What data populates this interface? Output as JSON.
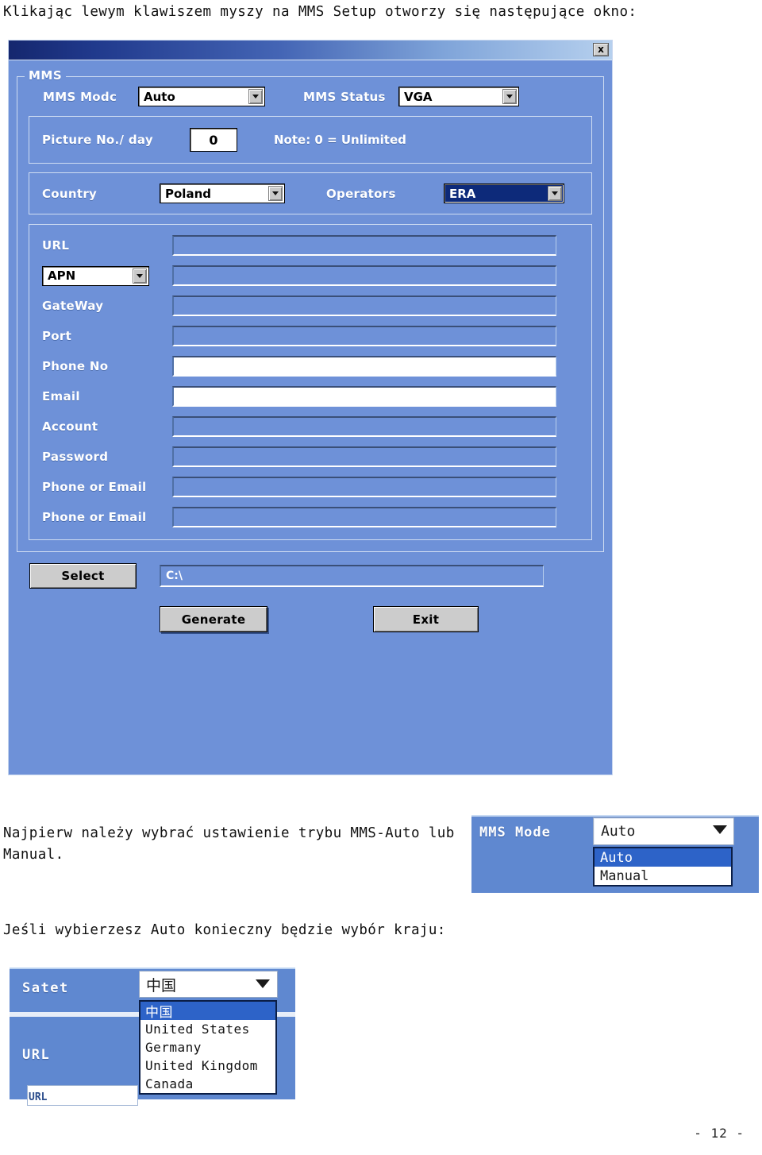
{
  "document": {
    "intro_text": "Klikając lewym klawiszem myszy na MMS Setup otworzy się następujące okno:",
    "middle_text_line1": "Najpierw należy wybrać ustawienie trybu MMS-Auto lub",
    "middle_text_line2": "Manual.",
    "third_text": "Jeśli wybierzesz Auto konieczny będzie wybór kraju:",
    "page_number": "- 12 -"
  },
  "dialog": {
    "close_label": "x",
    "mms_group": {
      "title": "MMS",
      "mode_label": "MMS Modc",
      "mode_value": "Auto",
      "status_label": "MMS Status",
      "status_value": "VGA",
      "picture_label": "Picture No./ day",
      "picture_value": "0",
      "picture_note": "Note: 0 = Unlimited",
      "country_label": "Country",
      "country_value": "Poland",
      "operators_label": "Operators",
      "operators_value": "ERA"
    },
    "network": {
      "url_label": "URL",
      "url_value": "",
      "apn_label": "APN",
      "apn_value": "",
      "gateway_label": "GateWay",
      "gateway_value": "",
      "port_label": "Port",
      "port_value": "",
      "phone_no_label": "Phone No",
      "phone_no_value": "",
      "email_label": "Email",
      "email_value": "",
      "account_label": "Account",
      "account_value": "",
      "password_label": "Password",
      "password_value": "",
      "phone_or_email_1_label": "Phone or Email",
      "phone_or_email_1_value": "",
      "phone_or_email_2_label": "Phone or Email",
      "phone_or_email_2_value": ""
    },
    "bottom": {
      "select_label": "Select",
      "path_value": "C:\\",
      "generate_label": "Generate",
      "exit_label": "Exit"
    }
  },
  "mms_mode_inset": {
    "label": "MMS Mode",
    "selected": "Auto",
    "options": [
      {
        "label": "Auto",
        "selected": true
      },
      {
        "label": "Manual",
        "selected": false
      }
    ]
  },
  "country_inset": {
    "label": "Satet",
    "url_label": "URL",
    "url_label_small": "URL",
    "selected": "中国",
    "options": [
      {
        "label": "中国",
        "selected": true
      },
      {
        "label": "United States",
        "selected": false
      },
      {
        "label": "Germany",
        "selected": false
      },
      {
        "label": "United Kingdom",
        "selected": false
      },
      {
        "label": "Canada",
        "selected": false
      }
    ]
  },
  "colors": {
    "dialog_background": "#6e91d8",
    "titlebar_dark": "#15276e",
    "titlebar_light": "#b6d0ee",
    "selection_blue": "#2d63c8",
    "operator_selected": "#0d2a7a",
    "button_face": "#cccccc"
  }
}
